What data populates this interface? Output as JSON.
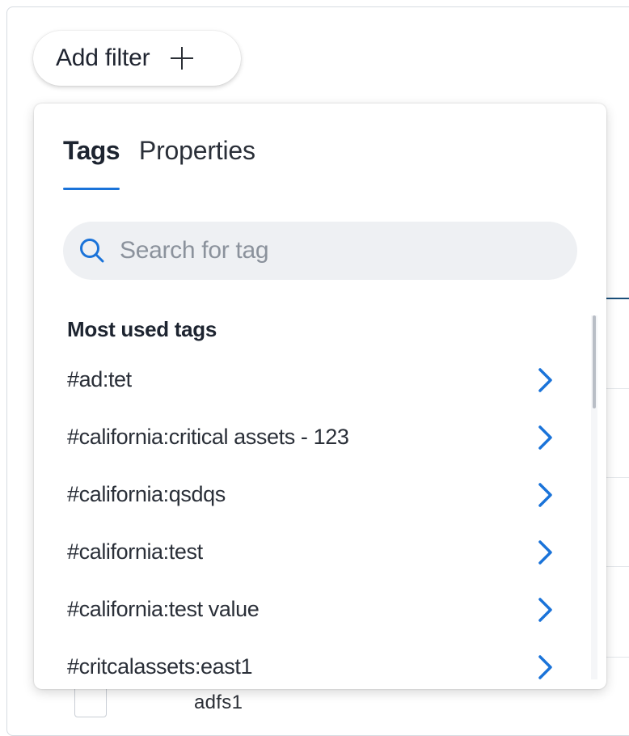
{
  "toolbar": {
    "add_filter_label": "Add filter",
    "add_filter_icon": "plus-icon"
  },
  "popover": {
    "tabs": [
      {
        "label": "Tags",
        "active": true
      },
      {
        "label": "Properties",
        "active": false
      }
    ],
    "search": {
      "placeholder": "Search for tag",
      "value": "",
      "icon": "search-icon"
    },
    "section_title": "Most used tags",
    "tags": [
      {
        "label": "#ad:tet"
      },
      {
        "label": "#california:critical assets - 123"
      },
      {
        "label": "#california:qsdqs"
      },
      {
        "label": "#california:test"
      },
      {
        "label": "#california:test value"
      },
      {
        "label": "#critcalassets:east1"
      }
    ],
    "item_icon": "chevron-right-icon"
  },
  "background": {
    "row_text": "adfs1"
  },
  "colors": {
    "accent": "#1a73d9",
    "search_bg": "#eef0f3",
    "text": "#2a2f38",
    "placeholder": "#8b929c"
  }
}
